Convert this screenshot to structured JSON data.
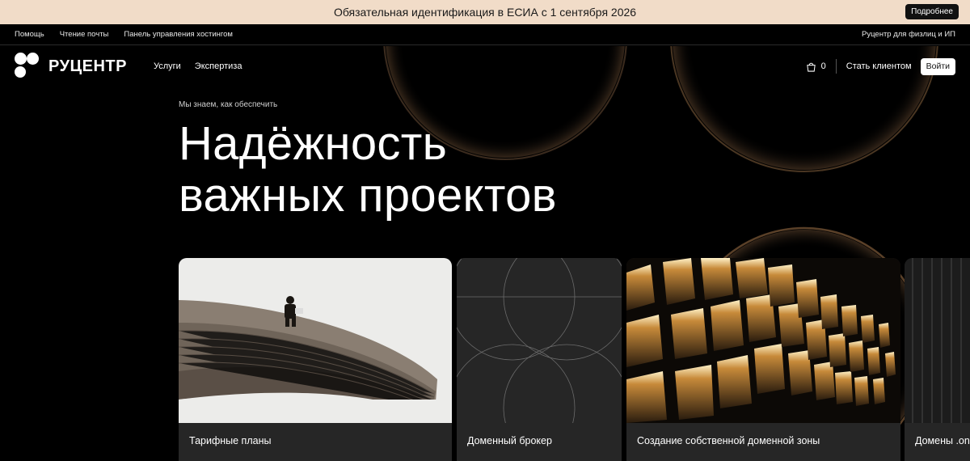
{
  "banner": {
    "text": "Обязательная идентификация в ЕСИА с 1 сентября 2026",
    "button": "Подробнее"
  },
  "util_nav": {
    "items": [
      "Помощь",
      "Чтение почты",
      "Панель управления хостингом"
    ],
    "right": "Руцентр для физлиц и ИП"
  },
  "header": {
    "logo": "РУЦЕНТР",
    "nav": [
      "Услуги",
      "Экспертиза"
    ],
    "cart_count": "0",
    "become_client": "Стать клиентом",
    "login": "Войти"
  },
  "hero": {
    "subtitle": "Мы знаем, как обеспечить",
    "title_line1": "Надёжность",
    "title_line2": "важных проектов"
  },
  "cards": [
    {
      "label": "Тарифные планы"
    },
    {
      "label": "Доменный брокер"
    },
    {
      "label": "Создание собственной доменной зоны"
    },
    {
      "label": "Домены .on"
    }
  ],
  "colors": {
    "banner_bg": "#f1dcc8",
    "page_bg": "#000000",
    "card_bg": "#262626"
  }
}
